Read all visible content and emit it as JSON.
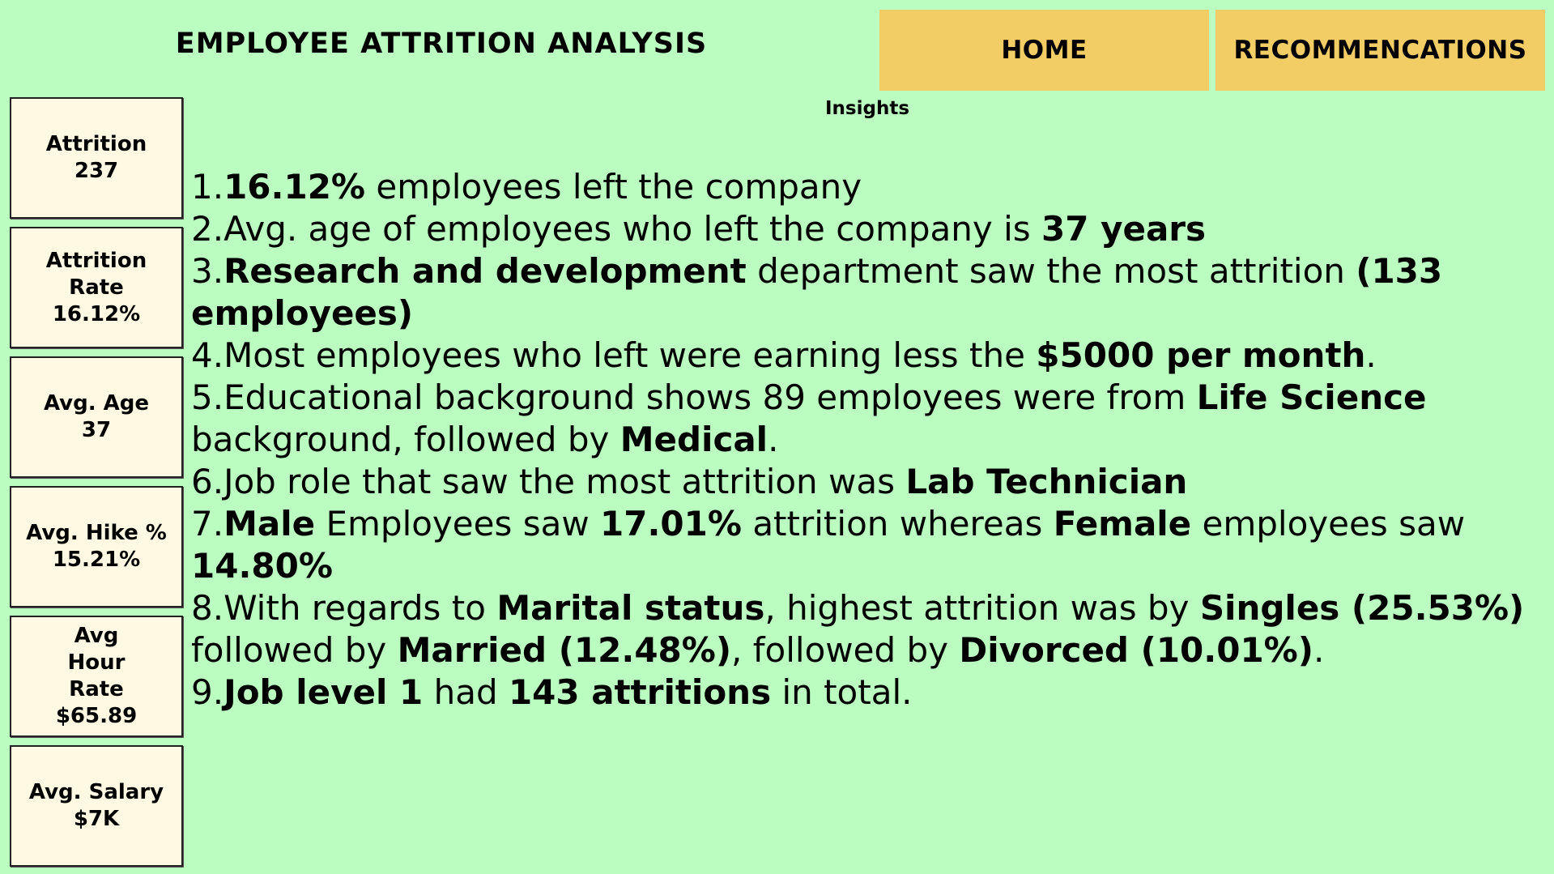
{
  "header": {
    "title": "EMPLOYEE ATTRITION ANALYSIS",
    "nav": {
      "home": "HOME",
      "recommendations": "RECOMMENCATIONS"
    }
  },
  "insights_heading": "Insights",
  "kpis": [
    {
      "label": "Attrition",
      "value": "237"
    },
    {
      "label": "Attrition Rate",
      "value": "16.12%"
    },
    {
      "label": "Avg. Age",
      "value": "37"
    },
    {
      "label": "Avg. Hike %",
      "value": "15.21%"
    },
    {
      "label": "Avg Hour Rate",
      "value": "$65.89"
    },
    {
      "label": "Avg. Salary",
      "value": "$7K"
    }
  ],
  "insights": [
    {
      "segments": [
        {
          "text": "1.",
          "bold": false
        },
        {
          "text": "16.12%",
          "bold": true
        },
        {
          "text": " employees left the company",
          "bold": false
        }
      ]
    },
    {
      "segments": [
        {
          "text": "2.Avg. age of employees who left the company is ",
          "bold": false
        },
        {
          "text": "37 years",
          "bold": true
        }
      ]
    },
    {
      "segments": [
        {
          "text": "3.",
          "bold": false
        },
        {
          "text": "Research and development",
          "bold": true
        },
        {
          "text": " department saw the most attrition ",
          "bold": false
        },
        {
          "text": "(133 employees)",
          "bold": true
        }
      ]
    },
    {
      "segments": [
        {
          "text": "4.Most employees who left were earning less the ",
          "bold": false
        },
        {
          "text": "$5000 per month",
          "bold": true
        },
        {
          "text": ".",
          "bold": false
        }
      ]
    },
    {
      "segments": [
        {
          "text": "5.Educational background shows 89 employees were from ",
          "bold": false
        },
        {
          "text": "Life Science",
          "bold": true
        },
        {
          "text": " background, followed by ",
          "bold": false
        },
        {
          "text": "Medical",
          "bold": true
        },
        {
          "text": ".",
          "bold": false
        }
      ]
    },
    {
      "segments": [
        {
          "text": "6.Job role that saw the most attrition was ",
          "bold": false
        },
        {
          "text": "Lab Technician",
          "bold": true
        }
      ]
    },
    {
      "segments": [
        {
          "text": "7.",
          "bold": false
        },
        {
          "text": "Male",
          "bold": true
        },
        {
          "text": " Employees saw ",
          "bold": false
        },
        {
          "text": "17.01%",
          "bold": true
        },
        {
          "text": " attrition whereas ",
          "bold": false
        },
        {
          "text": "Female",
          "bold": true
        },
        {
          "text": " employees saw ",
          "bold": false
        },
        {
          "text": "14.80%",
          "bold": true
        }
      ]
    },
    {
      "segments": [
        {
          "text": "8.With regards to ",
          "bold": false
        },
        {
          "text": "Marital status",
          "bold": true
        },
        {
          "text": ", highest attrition was by ",
          "bold": false
        },
        {
          "text": "Singles (25.53%)",
          "bold": true
        },
        {
          "text": " followed by ",
          "bold": false
        },
        {
          "text": "Married (12.48%)",
          "bold": true
        },
        {
          "text": ", followed by ",
          "bold": false
        },
        {
          "text": "Divorced (10.01%)",
          "bold": true
        },
        {
          "text": ".",
          "bold": false
        }
      ]
    },
    {
      "segments": [
        {
          "text": "9.",
          "bold": false
        },
        {
          "text": "Job level 1",
          "bold": true
        },
        {
          "text": " had ",
          "bold": false
        },
        {
          "text": "143 attritions",
          "bold": true
        },
        {
          "text": " in total.",
          "bold": false
        }
      ]
    }
  ],
  "colors": {
    "background": "#bbfcc0",
    "nav_button": "#f2cd66",
    "card_background": "#fff8e2"
  }
}
